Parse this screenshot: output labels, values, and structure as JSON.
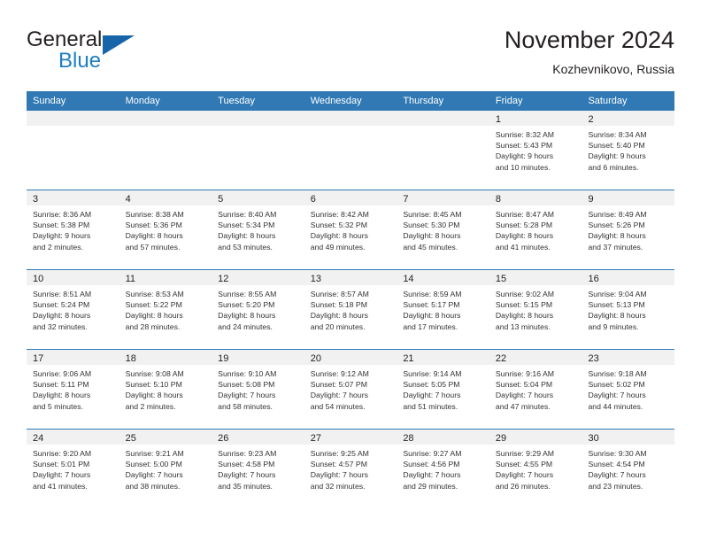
{
  "brand": {
    "name_line1": "General",
    "name_line2": "Blue",
    "accent_color": "#1c7fc4",
    "triangle_color": "#1765a8"
  },
  "header": {
    "title": "November 2024",
    "subtitle": "Kozhevnikovo, Russia"
  },
  "calendar": {
    "header_bg": "#3079b5",
    "day_band_bg": "#f1f1f1",
    "weekdays": [
      "Sunday",
      "Monday",
      "Tuesday",
      "Wednesday",
      "Thursday",
      "Friday",
      "Saturday"
    ],
    "weeks": [
      [
        {
          "day": "",
          "empty": true
        },
        {
          "day": "",
          "empty": true
        },
        {
          "day": "",
          "empty": true
        },
        {
          "day": "",
          "empty": true
        },
        {
          "day": "",
          "empty": true
        },
        {
          "day": "1",
          "sunrise": "Sunrise: 8:32 AM",
          "sunset": "Sunset: 5:43 PM",
          "daylight1": "Daylight: 9 hours",
          "daylight2": "and 10 minutes."
        },
        {
          "day": "2",
          "sunrise": "Sunrise: 8:34 AM",
          "sunset": "Sunset: 5:40 PM",
          "daylight1": "Daylight: 9 hours",
          "daylight2": "and 6 minutes."
        }
      ],
      [
        {
          "day": "3",
          "sunrise": "Sunrise: 8:36 AM",
          "sunset": "Sunset: 5:38 PM",
          "daylight1": "Daylight: 9 hours",
          "daylight2": "and 2 minutes."
        },
        {
          "day": "4",
          "sunrise": "Sunrise: 8:38 AM",
          "sunset": "Sunset: 5:36 PM",
          "daylight1": "Daylight: 8 hours",
          "daylight2": "and 57 minutes."
        },
        {
          "day": "5",
          "sunrise": "Sunrise: 8:40 AM",
          "sunset": "Sunset: 5:34 PM",
          "daylight1": "Daylight: 8 hours",
          "daylight2": "and 53 minutes."
        },
        {
          "day": "6",
          "sunrise": "Sunrise: 8:42 AM",
          "sunset": "Sunset: 5:32 PM",
          "daylight1": "Daylight: 8 hours",
          "daylight2": "and 49 minutes."
        },
        {
          "day": "7",
          "sunrise": "Sunrise: 8:45 AM",
          "sunset": "Sunset: 5:30 PM",
          "daylight1": "Daylight: 8 hours",
          "daylight2": "and 45 minutes."
        },
        {
          "day": "8",
          "sunrise": "Sunrise: 8:47 AM",
          "sunset": "Sunset: 5:28 PM",
          "daylight1": "Daylight: 8 hours",
          "daylight2": "and 41 minutes."
        },
        {
          "day": "9",
          "sunrise": "Sunrise: 8:49 AM",
          "sunset": "Sunset: 5:26 PM",
          "daylight1": "Daylight: 8 hours",
          "daylight2": "and 37 minutes."
        }
      ],
      [
        {
          "day": "10",
          "sunrise": "Sunrise: 8:51 AM",
          "sunset": "Sunset: 5:24 PM",
          "daylight1": "Daylight: 8 hours",
          "daylight2": "and 32 minutes."
        },
        {
          "day": "11",
          "sunrise": "Sunrise: 8:53 AM",
          "sunset": "Sunset: 5:22 PM",
          "daylight1": "Daylight: 8 hours",
          "daylight2": "and 28 minutes."
        },
        {
          "day": "12",
          "sunrise": "Sunrise: 8:55 AM",
          "sunset": "Sunset: 5:20 PM",
          "daylight1": "Daylight: 8 hours",
          "daylight2": "and 24 minutes."
        },
        {
          "day": "13",
          "sunrise": "Sunrise: 8:57 AM",
          "sunset": "Sunset: 5:18 PM",
          "daylight1": "Daylight: 8 hours",
          "daylight2": "and 20 minutes."
        },
        {
          "day": "14",
          "sunrise": "Sunrise: 8:59 AM",
          "sunset": "Sunset: 5:17 PM",
          "daylight1": "Daylight: 8 hours",
          "daylight2": "and 17 minutes."
        },
        {
          "day": "15",
          "sunrise": "Sunrise: 9:02 AM",
          "sunset": "Sunset: 5:15 PM",
          "daylight1": "Daylight: 8 hours",
          "daylight2": "and 13 minutes."
        },
        {
          "day": "16",
          "sunrise": "Sunrise: 9:04 AM",
          "sunset": "Sunset: 5:13 PM",
          "daylight1": "Daylight: 8 hours",
          "daylight2": "and 9 minutes."
        }
      ],
      [
        {
          "day": "17",
          "sunrise": "Sunrise: 9:06 AM",
          "sunset": "Sunset: 5:11 PM",
          "daylight1": "Daylight: 8 hours",
          "daylight2": "and 5 minutes."
        },
        {
          "day": "18",
          "sunrise": "Sunrise: 9:08 AM",
          "sunset": "Sunset: 5:10 PM",
          "daylight1": "Daylight: 8 hours",
          "daylight2": "and 2 minutes."
        },
        {
          "day": "19",
          "sunrise": "Sunrise: 9:10 AM",
          "sunset": "Sunset: 5:08 PM",
          "daylight1": "Daylight: 7 hours",
          "daylight2": "and 58 minutes."
        },
        {
          "day": "20",
          "sunrise": "Sunrise: 9:12 AM",
          "sunset": "Sunset: 5:07 PM",
          "daylight1": "Daylight: 7 hours",
          "daylight2": "and 54 minutes."
        },
        {
          "day": "21",
          "sunrise": "Sunrise: 9:14 AM",
          "sunset": "Sunset: 5:05 PM",
          "daylight1": "Daylight: 7 hours",
          "daylight2": "and 51 minutes."
        },
        {
          "day": "22",
          "sunrise": "Sunrise: 9:16 AM",
          "sunset": "Sunset: 5:04 PM",
          "daylight1": "Daylight: 7 hours",
          "daylight2": "and 47 minutes."
        },
        {
          "day": "23",
          "sunrise": "Sunrise: 9:18 AM",
          "sunset": "Sunset: 5:02 PM",
          "daylight1": "Daylight: 7 hours",
          "daylight2": "and 44 minutes."
        }
      ],
      [
        {
          "day": "24",
          "sunrise": "Sunrise: 9:20 AM",
          "sunset": "Sunset: 5:01 PM",
          "daylight1": "Daylight: 7 hours",
          "daylight2": "and 41 minutes."
        },
        {
          "day": "25",
          "sunrise": "Sunrise: 9:21 AM",
          "sunset": "Sunset: 5:00 PM",
          "daylight1": "Daylight: 7 hours",
          "daylight2": "and 38 minutes."
        },
        {
          "day": "26",
          "sunrise": "Sunrise: 9:23 AM",
          "sunset": "Sunset: 4:58 PM",
          "daylight1": "Daylight: 7 hours",
          "daylight2": "and 35 minutes."
        },
        {
          "day": "27",
          "sunrise": "Sunrise: 9:25 AM",
          "sunset": "Sunset: 4:57 PM",
          "daylight1": "Daylight: 7 hours",
          "daylight2": "and 32 minutes."
        },
        {
          "day": "28",
          "sunrise": "Sunrise: 9:27 AM",
          "sunset": "Sunset: 4:56 PM",
          "daylight1": "Daylight: 7 hours",
          "daylight2": "and 29 minutes."
        },
        {
          "day": "29",
          "sunrise": "Sunrise: 9:29 AM",
          "sunset": "Sunset: 4:55 PM",
          "daylight1": "Daylight: 7 hours",
          "daylight2": "and 26 minutes."
        },
        {
          "day": "30",
          "sunrise": "Sunrise: 9:30 AM",
          "sunset": "Sunset: 4:54 PM",
          "daylight1": "Daylight: 7 hours",
          "daylight2": "and 23 minutes."
        }
      ]
    ]
  }
}
